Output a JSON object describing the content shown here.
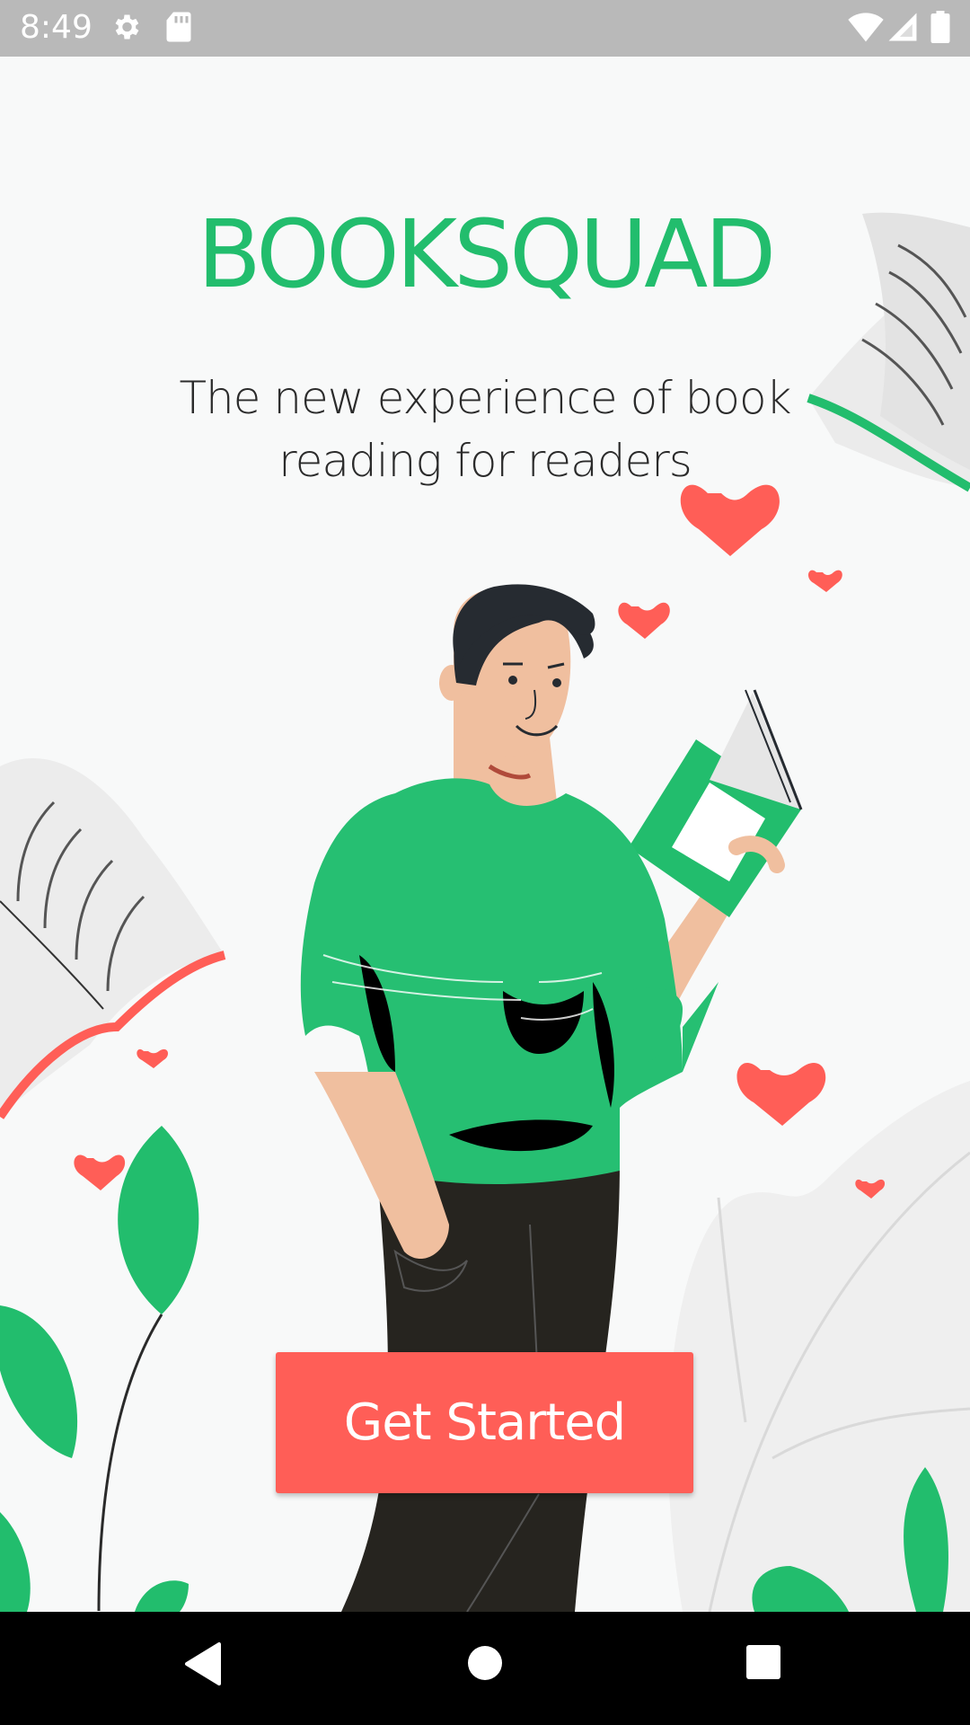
{
  "status_bar": {
    "time": "8:49",
    "icons": [
      "gear-icon",
      "sd-card-icon",
      "wifi-icon",
      "cellular-signal-icon",
      "battery-icon"
    ]
  },
  "app": {
    "title": "BOOKSQUAD",
    "subtitle_line1": "The new experience of book",
    "subtitle_line2": "reading for readers",
    "cta_label": "Get Started"
  },
  "nav_bar": {
    "icons": [
      "back-icon",
      "home-icon",
      "recents-icon"
    ]
  },
  "colors": {
    "brand_green": "#22bd6d",
    "accent_red": "#ff5e57",
    "status_bar": "#b9b9b9",
    "background": "#f8f9f9"
  }
}
